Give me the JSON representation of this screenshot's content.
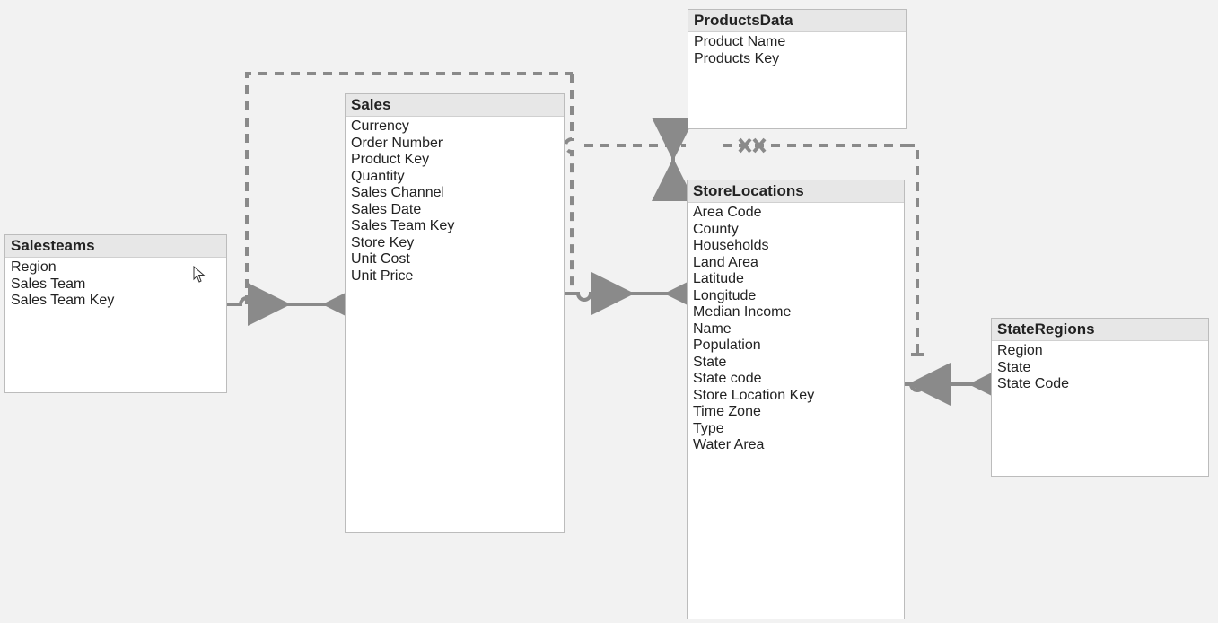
{
  "diagram": {
    "tables": {
      "salesteams": {
        "title": "Salesteams",
        "fields": [
          "Region",
          "Sales Team",
          "Sales Team Key"
        ]
      },
      "sales": {
        "title": "Sales",
        "fields": [
          "Currency",
          "Order Number",
          "Product Key",
          "Quantity",
          "Sales Channel",
          "Sales Date",
          "Sales Team Key",
          "Store Key",
          "Unit Cost",
          "Unit Price"
        ]
      },
      "productsdata": {
        "title": "ProductsData",
        "fields": [
          "Product Name",
          "Products Key"
        ]
      },
      "storelocations": {
        "title": "StoreLocations",
        "fields": [
          "Area Code",
          "County",
          "Households",
          "Land Area",
          "Latitude",
          "Longitude",
          "Median Income",
          "Name",
          "Population",
          "State",
          "State code",
          "Store Location Key",
          "Time Zone",
          "Type",
          "Water Area"
        ]
      },
      "stateregions": {
        "title": "StateRegions",
        "fields": [
          "Region",
          "State",
          "State Code"
        ]
      }
    },
    "relationships": [
      {
        "from": "Salesteams",
        "to": "Sales",
        "style": "solid"
      },
      {
        "from": "Sales",
        "to": "ProductsData",
        "style": "dashed"
      },
      {
        "from": "Sales",
        "to": "StoreLocations",
        "style": "solid"
      },
      {
        "from": "ProductsData",
        "to": "StoreLocations",
        "style": "solid"
      },
      {
        "from": "StoreLocations",
        "to": "StateRegions",
        "style": "solid"
      },
      {
        "from": "ProductsData",
        "to": "StateRegions",
        "style": "dashed"
      }
    ],
    "colors": {
      "canvas_bg": "#f2f2f2",
      "box_bg": "#ffffff",
      "box_border": "#bcbcbc",
      "header_bg": "#e7e7e7",
      "connector": "#8a8a8a"
    }
  }
}
